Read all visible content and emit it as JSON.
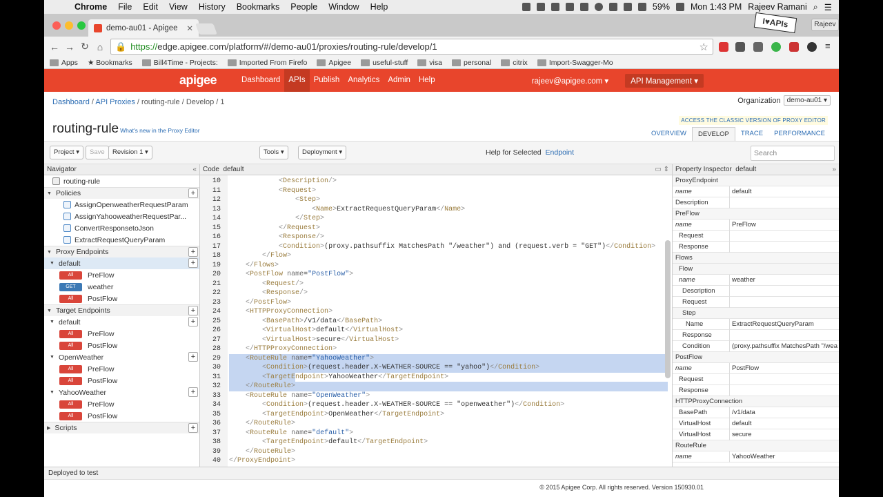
{
  "menubar": {
    "app": "Chrome",
    "items": [
      "File",
      "Edit",
      "View",
      "History",
      "Bookmarks",
      "People",
      "Window",
      "Help"
    ],
    "battery": "59%",
    "clock": "Mon 1:43 PM",
    "user": "Rajeev Ramani"
  },
  "browser": {
    "tab_title": "demo-au01 - Apigee",
    "profile": "Rajeev",
    "url_scheme": "https://",
    "url_rest": "edge.apigee.com/platform/#/demo-au01/proxies/routing-rule/develop/1",
    "sticker": "I♥APIs",
    "bookmarks": [
      "Apps",
      "Bookmarks",
      "Bill4Time - Projects:",
      "Imported From Firefo",
      "Apigee",
      "useful-stuff",
      "visa",
      "personal",
      "citrix",
      "Import-Swagger-Mo"
    ]
  },
  "header": {
    "logo": "apigee",
    "nav": [
      "Dashboard",
      "APIs",
      "Publish",
      "Analytics",
      "Admin",
      "Help"
    ],
    "active_nav": "APIs",
    "user_email": "rajeev@apigee.com ▾",
    "api_management": "API Management ▾"
  },
  "breadcrumb": [
    "Dashboard",
    "API Proxies",
    "routing-rule",
    "Develop",
    "1"
  ],
  "organization": {
    "label": "Organization",
    "value": "demo-au01 ▾"
  },
  "classic_link": "ACCESS THE CLASSIC VERSION OF PROXY EDITOR",
  "page": {
    "title": "routing-rule",
    "whats_new": "What's new in the Proxy Editor"
  },
  "tabs": [
    "OVERVIEW",
    "DEVELOP",
    "TRACE",
    "PERFORMANCE"
  ],
  "toolbar": {
    "project": "Project ▾",
    "save": "Save",
    "revision": "Revision 1 ▾",
    "tools": "Tools ▾",
    "deployment": "Deployment ▾",
    "help_label": "Help for Selected",
    "help_link": "Endpoint",
    "search_placeholder": "Search"
  },
  "navigator": {
    "title": "Navigator",
    "collapse": "«",
    "root": "routing-rule",
    "policies_label": "Policies",
    "policies": [
      "AssignOpenweatherRequestParam",
      "AssignYahooweatherRequestPar...",
      "ConvertResponsetoJson",
      "ExtractRequestQueryParam"
    ],
    "proxy_endpoints_label": "Proxy Endpoints",
    "proxy_default": "default",
    "proxy_flows": [
      {
        "badge": "All",
        "name": "PreFlow"
      },
      {
        "badge": "GET",
        "name": "weather"
      },
      {
        "badge": "All",
        "name": "PostFlow"
      }
    ],
    "target_endpoints_label": "Target Endpoints",
    "targets": [
      {
        "name": "default",
        "flows": [
          {
            "badge": "All",
            "name": "PreFlow"
          },
          {
            "badge": "All",
            "name": "PostFlow"
          }
        ]
      },
      {
        "name": "OpenWeather",
        "flows": [
          {
            "badge": "All",
            "name": "PreFlow"
          },
          {
            "badge": "All",
            "name": "PostFlow"
          }
        ]
      },
      {
        "name": "YahooWeather",
        "flows": [
          {
            "badge": "All",
            "name": "PreFlow"
          },
          {
            "badge": "All",
            "name": "PostFlow"
          }
        ]
      }
    ],
    "scripts_label": "Scripts"
  },
  "code": {
    "label": "Code",
    "file": "default",
    "highlighted_lines": [
      29,
      30,
      31,
      32
    ],
    "lines": [
      {
        "n": "10",
        "t": "            <Description/>"
      },
      {
        "n": "11",
        "t": "            <Request>"
      },
      {
        "n": "12",
        "t": "                <Step>"
      },
      {
        "n": "13",
        "t": "                    <Name>ExtractRequestQueryParam</Name>"
      },
      {
        "n": "14",
        "t": "                </Step>"
      },
      {
        "n": "15",
        "t": "            </Request>"
      },
      {
        "n": "16",
        "t": "            <Response/>"
      },
      {
        "n": "17",
        "t": "            <Condition>(proxy.pathsuffix MatchesPath \"/weather\") and (request.verb = \"GET\")</Condition>"
      },
      {
        "n": "18",
        "t": "        </Flow>"
      },
      {
        "n": "19",
        "t": "    </Flows>"
      },
      {
        "n": "20",
        "t": "    <PostFlow name=\"PostFlow\">"
      },
      {
        "n": "21",
        "t": "        <Request/>"
      },
      {
        "n": "22",
        "t": "        <Response/>"
      },
      {
        "n": "23",
        "t": "    </PostFlow>"
      },
      {
        "n": "24",
        "t": "    <HTTPProxyConnection>"
      },
      {
        "n": "25",
        "t": "        <BasePath>/v1/data</BasePath>"
      },
      {
        "n": "26",
        "t": "        <VirtualHost>default</VirtualHost>"
      },
      {
        "n": "27",
        "t": "        <VirtualHost>secure</VirtualHost>"
      },
      {
        "n": "28",
        "t": "    </HTTPProxyConnection>"
      },
      {
        "n": "29",
        "t": "    <RouteRule name=\"YahooWeather\">"
      },
      {
        "n": "30",
        "t": "        <Condition>(request.header.X-WEATHER-SOURCE == \"yahoo\")</Condition>"
      },
      {
        "n": "31",
        "t": "        <TargetEndpoint>YahooWeather</TargetEndpoint>"
      },
      {
        "n": "32",
        "t": "    </RouteRule>"
      },
      {
        "n": "33",
        "t": "    <RouteRule name=\"OpenWeather\">"
      },
      {
        "n": "34",
        "t": "        <Condition>(request.header.X-WEATHER-SOURCE == \"openweather\")</Condition>"
      },
      {
        "n": "35",
        "t": "        <TargetEndpoint>OpenWeather</TargetEndpoint>"
      },
      {
        "n": "36",
        "t": "    </RouteRule>"
      },
      {
        "n": "37",
        "t": "    <RouteRule name=\"default\">"
      },
      {
        "n": "38",
        "t": "        <TargetEndpoint>default</TargetEndpoint>"
      },
      {
        "n": "39",
        "t": "    </RouteRule>"
      },
      {
        "n": "40",
        "t": "</ProxyEndpoint>"
      }
    ]
  },
  "inspector": {
    "title": "Property Inspector",
    "target": "default",
    "rows": [
      {
        "k": "ProxyEndpoint",
        "v": null,
        "grp": true,
        "ind": 0
      },
      {
        "k": "name",
        "v": "default",
        "it": true,
        "ind": 0
      },
      {
        "k": "Description",
        "v": "",
        "ind": 0
      },
      {
        "k": "PreFlow",
        "v": null,
        "grp": true,
        "ind": 0
      },
      {
        "k": "name",
        "v": "PreFlow",
        "it": true,
        "ind": 0
      },
      {
        "k": "Request",
        "v": "",
        "ind": 1
      },
      {
        "k": "Response",
        "v": "",
        "ind": 1
      },
      {
        "k": "Flows",
        "v": null,
        "grp": true,
        "ind": 0
      },
      {
        "k": "Flow",
        "v": null,
        "grp": true,
        "ind": 1
      },
      {
        "k": "name",
        "v": "weather",
        "it": true,
        "ind": 1
      },
      {
        "k": "Description",
        "v": "",
        "ind": 2
      },
      {
        "k": "Request",
        "v": "",
        "ind": 2
      },
      {
        "k": "Step",
        "v": null,
        "grp": true,
        "ind": 2
      },
      {
        "k": "Name",
        "v": "ExtractRequestQueryParam",
        "ind": 3
      },
      {
        "k": "Response",
        "v": "",
        "ind": 2
      },
      {
        "k": "Condition",
        "v": "(proxy.pathsuffix MatchesPath \"/wea",
        "ind": 2
      },
      {
        "k": "PostFlow",
        "v": null,
        "grp": true,
        "ind": 0
      },
      {
        "k": "name",
        "v": "PostFlow",
        "it": true,
        "ind": 0
      },
      {
        "k": "Request",
        "v": "",
        "ind": 1
      },
      {
        "k": "Response",
        "v": "",
        "ind": 1
      },
      {
        "k": "HTTPProxyConnection",
        "v": null,
        "grp": true,
        "ind": 0
      },
      {
        "k": "BasePath",
        "v": "/v1/data",
        "ind": 1
      },
      {
        "k": "VirtualHost",
        "v": "default",
        "ind": 1
      },
      {
        "k": "VirtualHost",
        "v": "secure",
        "ind": 1
      },
      {
        "k": "RouteRule",
        "v": null,
        "grp": true,
        "ind": 0
      },
      {
        "k": "name",
        "v": "YahooWeather",
        "it": true,
        "ind": 0
      }
    ]
  },
  "status": "Deployed to test",
  "footer": "© 2015 Apigee Corp. All rights reserved. Version 150930.01",
  "colors": {
    "brand": "#e8452c",
    "link": "#2b6cb3",
    "selection": "#c5d6f1"
  }
}
